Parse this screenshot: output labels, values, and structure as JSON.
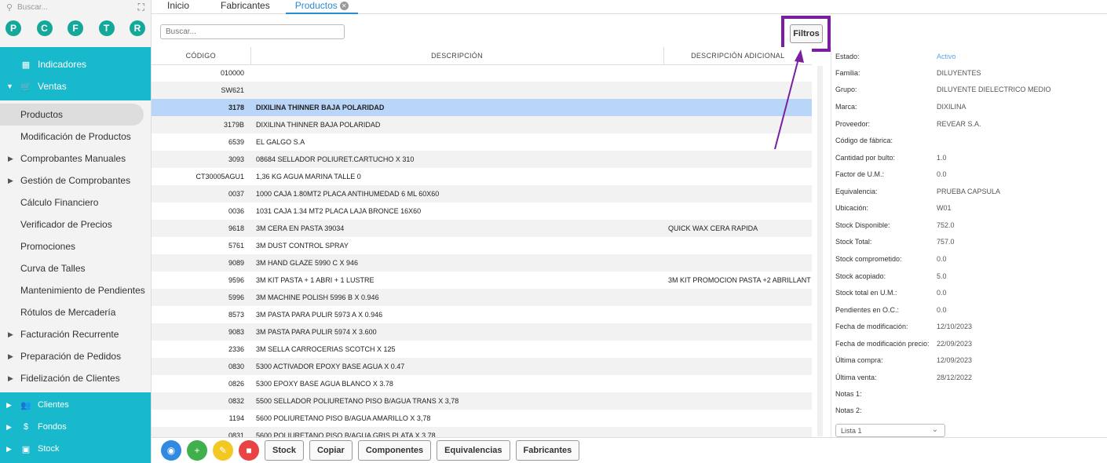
{
  "sidebar": {
    "search_placeholder": "Buscar...",
    "letters": [
      "P",
      "C",
      "F",
      "T",
      "R"
    ],
    "top_items": [
      {
        "label": "Indicadores",
        "icon": "grid-icon"
      },
      {
        "label": "Ventas",
        "icon": "cart-icon"
      }
    ],
    "sub_items": [
      {
        "label": "Productos",
        "caret": false
      },
      {
        "label": "Modificación de Productos",
        "caret": false
      },
      {
        "label": "Comprobantes Manuales",
        "caret": true
      },
      {
        "label": "Gestión de Comprobantes",
        "caret": true
      },
      {
        "label": "Cálculo Financiero",
        "caret": false
      },
      {
        "label": "Verificador de Precios",
        "caret": false
      },
      {
        "label": "Promociones",
        "caret": false
      },
      {
        "label": "Curva de Talles",
        "caret": false
      },
      {
        "label": "Mantenimiento de Pendientes",
        "caret": false
      },
      {
        "label": "Rótulos de Mercadería",
        "caret": false
      },
      {
        "label": "Facturación Recurrente",
        "caret": true
      },
      {
        "label": "Preparación de Pedidos",
        "caret": true
      },
      {
        "label": "Fidelización de Clientes",
        "caret": true
      }
    ],
    "bottom_items": [
      {
        "label": "Clientes",
        "icon": "users-icon"
      },
      {
        "label": "Fondos",
        "icon": "dollar-icon"
      },
      {
        "label": "Stock",
        "icon": "box-icon"
      }
    ]
  },
  "tabs": [
    "Inicio",
    "Fabricantes",
    "Productos"
  ],
  "search_placeholder": "Buscar...",
  "filtros_label": "Filtros",
  "table": {
    "headers": [
      "CÓDIGO",
      "DESCRIPCIÓN",
      "DESCRIPCIÓN ADICIONAL"
    ],
    "rows": [
      [
        "010000",
        "",
        ""
      ],
      [
        "SW621",
        "",
        ""
      ],
      [
        "3178",
        "DIXILINA THINNER BAJA POLARIDAD",
        ""
      ],
      [
        "3179B",
        "DIXILINA THINNER BAJA POLARIDAD",
        ""
      ],
      [
        "6539",
        "EL GALGO S.A",
        ""
      ],
      [
        "3093",
        "08684 SELLADOR POLIURET.CARTUCHO X 310",
        ""
      ],
      [
        "CT30005AGU1",
        "1,36 KG AGUA MARINA TALLE 0",
        ""
      ],
      [
        "0037",
        "1000 CAJA 1.80MT2 PLACA ANTIHUMEDAD 6 ML 60X60",
        ""
      ],
      [
        "0036",
        "1031 CAJA 1.34 MT2 PLACA LAJA BRONCE 16X60",
        ""
      ],
      [
        "9618",
        "3M CERA EN PASTA 39034",
        "QUICK WAX CERA RAPIDA"
      ],
      [
        "5761",
        "3M DUST CONTROL SPRAY",
        ""
      ],
      [
        "9089",
        "3M HAND GLAZE 5990 C X 946",
        ""
      ],
      [
        "9596",
        "3M KIT PASTA + 1 ABRI + 1 LUSTRE",
        "3M KIT PROMOCION PASTA +2 ABRILLANT"
      ],
      [
        "5996",
        "3M MACHINE POLISH 5996 B X 0.946",
        ""
      ],
      [
        "8573",
        "3M PASTA PARA PULIR 5973 A X 0.946",
        ""
      ],
      [
        "9083",
        "3M PASTA PARA PULIR 5974 X 3.600",
        ""
      ],
      [
        "2336",
        "3M SELLA CARROCERIAS SCOTCH X 125",
        ""
      ],
      [
        "0830",
        "5300 ACTIVADOR EPOXY BASE AGUA X 0.47",
        ""
      ],
      [
        "0826",
        "5300 EPOXY BASE AGUA BLANCO X 3.78",
        ""
      ],
      [
        "0832",
        "5500 SELLADOR POLIURETANO PISO B/AGUA TRANS X 3,78",
        ""
      ],
      [
        "1194",
        "5600 POLIURETANO PISO B/AGUA AMARILLO X 3,78",
        ""
      ],
      [
        "0831",
        "5600 POLIURETANO PISO B/AGUA GRIS PLATA X 3,78",
        ""
      ]
    ],
    "selected_row": 2
  },
  "detail": {
    "fields": [
      {
        "label": "Estado:",
        "value": "Activo",
        "status": true
      },
      {
        "label": "Familia:",
        "value": "DILUYENTES"
      },
      {
        "label": "Grupo:",
        "value": "DILUYENTE DIELECTRICO MEDIO"
      },
      {
        "label": "Marca:",
        "value": "DIXILINA"
      },
      {
        "label": "Proveedor:",
        "value": "REVEAR S.A."
      },
      {
        "label": "Código de fábrica:",
        "value": ""
      },
      {
        "label": "Cantidad por bulto:",
        "value": "1.0"
      },
      {
        "label": "Factor de U.M.:",
        "value": "0.0"
      },
      {
        "label": "Equivalencia:",
        "value": "PRUEBA CAPSULA"
      },
      {
        "label": "Ubicación:",
        "value": "W01"
      },
      {
        "label": "Stock Disponible:",
        "value": "752.0"
      },
      {
        "label": "Stock Total:",
        "value": "757.0"
      },
      {
        "label": "Stock comprometido:",
        "value": "0.0"
      },
      {
        "label": "Stock acopiado:",
        "value": "5.0"
      },
      {
        "label": "Stock total en U.M.:",
        "value": "0.0"
      },
      {
        "label": "Pendientes en O.C.:",
        "value": "0.0"
      },
      {
        "label": "Fecha de modificación:",
        "value": "12/10/2023"
      },
      {
        "label": "Fecha de modificación precio:",
        "value": "22/09/2023"
      },
      {
        "label": "Última compra:",
        "value": "12/09/2023"
      },
      {
        "label": "Última venta:",
        "value": "28/12/2022"
      },
      {
        "label": "Notas 1:",
        "value": ""
      },
      {
        "label": "Notas 2:",
        "value": ""
      }
    ],
    "lista_value": "Lista 1"
  },
  "bottom_buttons": [
    "Stock",
    "Copiar",
    "Componentes",
    "Equivalencias",
    "Fabricantes"
  ],
  "colors": {
    "teal": "#18b9cc",
    "letter_green": "#14a89a",
    "tab_blue": "#2a8bd6",
    "selection": "#b9d5f7",
    "highlight": "#7a1fa0"
  }
}
